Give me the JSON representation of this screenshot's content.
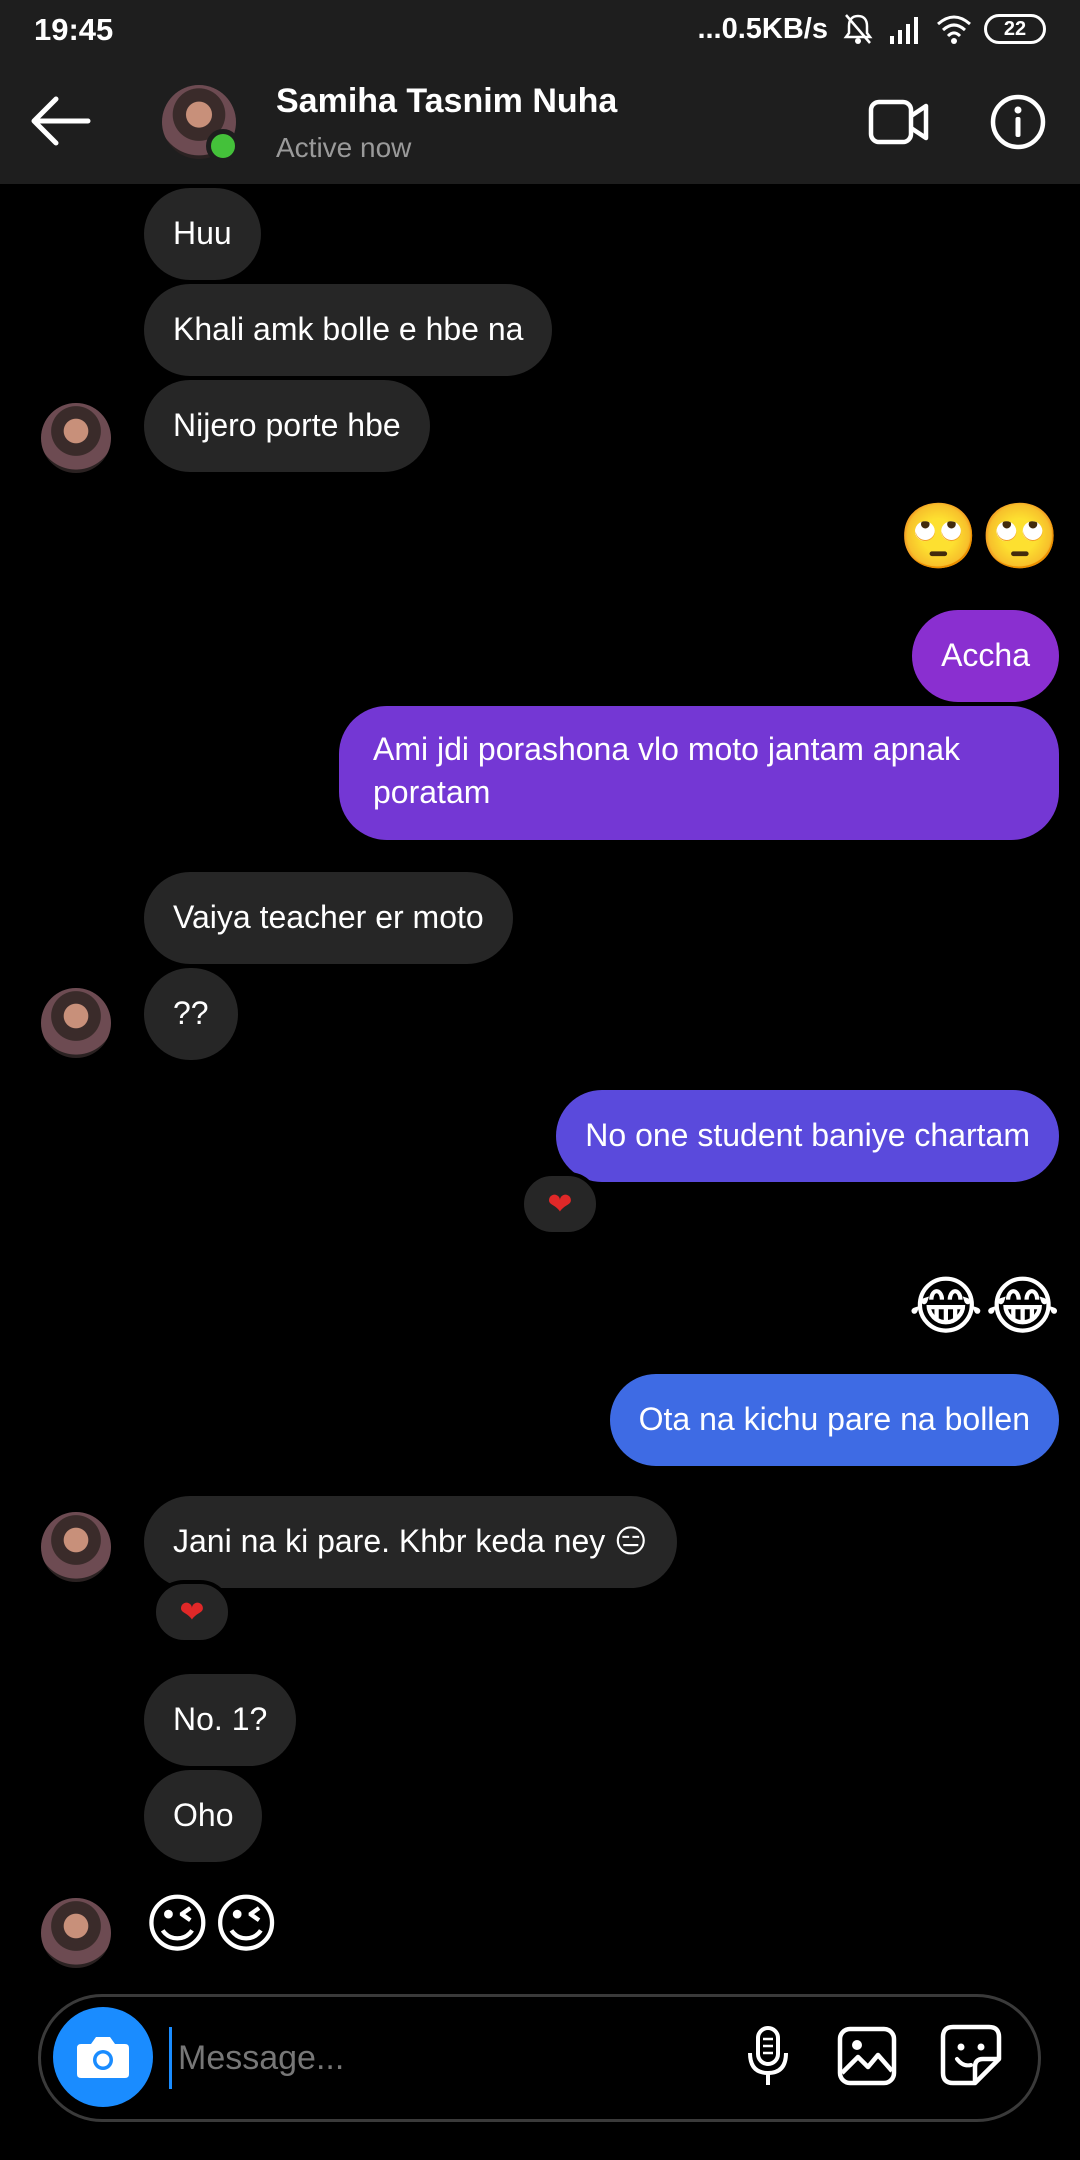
{
  "status_bar": {
    "time": "19:45",
    "speed": "...0.5KB/s",
    "battery": "22",
    "icons": [
      "mute-icon",
      "signal-icon",
      "wifi-icon",
      "battery-icon"
    ]
  },
  "header": {
    "name": "Samiha Tasnim Nuha",
    "status": "Active now",
    "icons": [
      "back-arrow-icon",
      "video-camera-icon",
      "info-icon"
    ],
    "online_color": "#44c13a"
  },
  "messages": [
    {
      "from": "them",
      "text": "Huu"
    },
    {
      "from": "them",
      "text": "Khali amk bolle e hbe na"
    },
    {
      "from": "them",
      "text": "Nijero porte hbe"
    },
    {
      "from": "me",
      "text": "🙄🙄"
    },
    {
      "from": "me",
      "text": "Accha"
    },
    {
      "from": "me",
      "text": "Ami jdi porashona vlo moto jantam apnak poratam"
    },
    {
      "from": "them",
      "text": "Vaiya teacher er moto"
    },
    {
      "from": "them",
      "text": "??"
    },
    {
      "from": "me",
      "text": "No one student baniye chartam",
      "reaction": "❤"
    },
    {
      "from": "me",
      "text": "😂😂"
    },
    {
      "from": "me",
      "text": "Ota na kichu pare na bollen"
    },
    {
      "from": "them",
      "text": "Jani na ki pare. Khbr keda ney 😑",
      "reaction": "❤"
    },
    {
      "from": "them",
      "text": "No. 1?"
    },
    {
      "from": "them",
      "text": "Oho"
    },
    {
      "from": "them",
      "text": "😉😉"
    }
  ],
  "colors": {
    "incoming_bubble": "#262626",
    "outgoing_gradient": [
      "#8a2fd0",
      "#6b3bd8",
      "#4f55e0",
      "#3e6be4"
    ],
    "accent": "#1a8cff",
    "reaction": "#e02828"
  },
  "composer": {
    "placeholder": "Message...",
    "icons": [
      "camera-icon",
      "microphone-icon",
      "gallery-icon",
      "sticker-icon"
    ]
  }
}
